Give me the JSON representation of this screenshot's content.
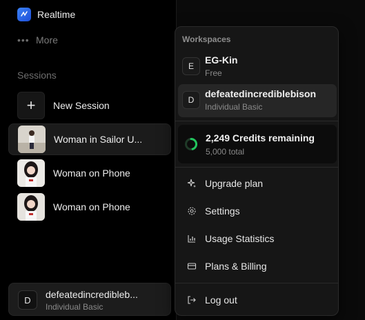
{
  "sidebar": {
    "realtime_label": "Realtime",
    "more_label": "More",
    "sessions_title": "Sessions",
    "new_session_label": "New Session",
    "sessions": [
      {
        "label": "Woman in Sailor U...",
        "active": true
      },
      {
        "label": "Woman on Phone",
        "active": false
      },
      {
        "label": "Woman on Phone",
        "active": false
      }
    ],
    "user": {
      "initial": "D",
      "name": "defeatedincredibleb...",
      "plan": "Individual Basic"
    }
  },
  "menu": {
    "workspaces_title": "Workspaces",
    "workspaces": [
      {
        "initial": "E",
        "name": "EG-Kin",
        "plan": "Free",
        "selected": false
      },
      {
        "initial": "D",
        "name": "defeatedincrediblebison",
        "plan": "Individual Basic",
        "selected": true
      }
    ],
    "credits": {
      "main": "2,249 Credits remaining",
      "sub": "5,000 total",
      "remaining": 2249,
      "total": 5000
    },
    "items": [
      {
        "label": "Upgrade plan",
        "icon": "sparkle-icon"
      },
      {
        "label": "Settings",
        "icon": "gear-icon"
      },
      {
        "label": "Usage Statistics",
        "icon": "bar-chart-icon"
      },
      {
        "label": "Plans & Billing",
        "icon": "credit-card-icon"
      }
    ],
    "logout_label": "Log out"
  },
  "colors": {
    "accent_green": "#22c55e",
    "realtime_blue": "#2563eb"
  }
}
